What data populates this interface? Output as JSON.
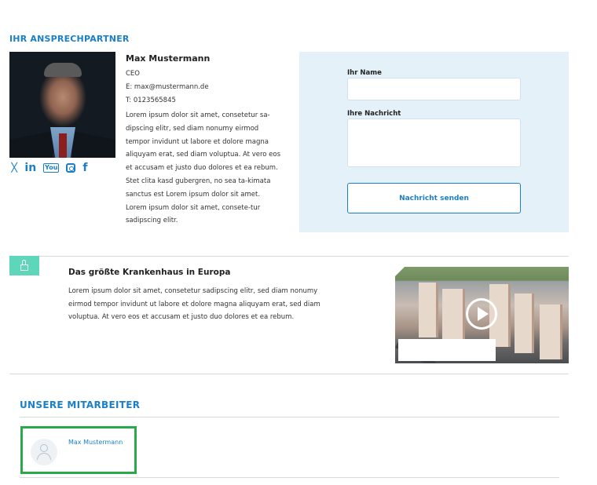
{
  "contact": {
    "section_title": "IHR ANSPRECHPARTNER",
    "name": "Max Mustermann",
    "role": "CEO",
    "email": "E: max@mustermann.de",
    "phone": "T: 0123565845",
    "bio": "Lorem ipsum dolor sit amet, consetetur sa-dipscing elitr, sed diam nonumy eirmod tempor invidunt ut labore et dolore magna aliquyam erat, sed diam voluptua. At vero eos et accusam et justo duo dolores et ea rebum. Stet clita kasd gubergren, no sea ta-kimata sanctus est Lorem ipsum dolor sit amet. Lorem ipsum dolor sit amet, consete-tur sadipscing elitr.",
    "social": {
      "xing_icon": "𝕏",
      "linkedin_icon": "in",
      "youtube_icon": "You",
      "facebook_icon": "f"
    }
  },
  "form": {
    "name_label": "Ihr Name",
    "name_value": "",
    "message_label": "Ihre Nachricht",
    "message_value": "",
    "submit_label": "Nachricht senden"
  },
  "feature": {
    "title": "Das größte Krankenhaus in Europa",
    "text": "Lorem ipsum dolor sit amet, consetetur sadipscing elitr, sed diam nonumy eirmod tempor invidunt ut labore et dolore magna aliquyam erat, sed diam voluptua. At vero eos et accusam et justo duo dolores et ea rebum."
  },
  "staff": {
    "section_title": "UNSERE MITARBEITER",
    "members": [
      {
        "name": "Max Mustermann"
      }
    ]
  },
  "colors": {
    "accent": "#1a7fc9",
    "form_bg": "#e5f1f9",
    "lock_badge": "#5dd6b9",
    "highlight": "#2aa84a"
  }
}
